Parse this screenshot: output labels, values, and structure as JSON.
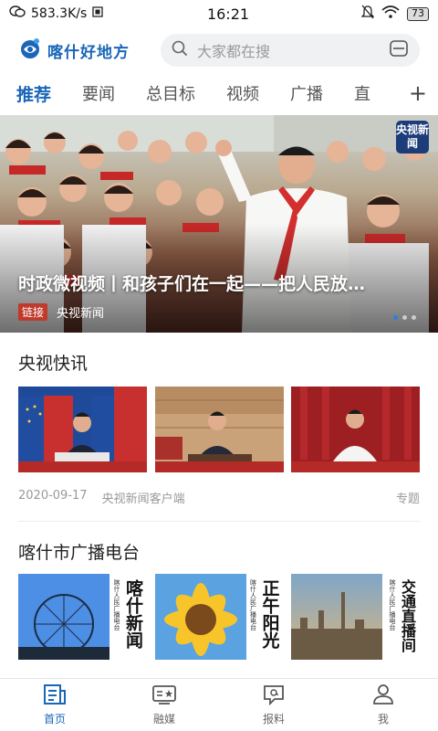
{
  "status_bar": {
    "net_speed": "583.3K/s",
    "time": "16:21",
    "battery": "73"
  },
  "header": {
    "logo_text": "喀什好地方",
    "search_placeholder": "大家都在搜"
  },
  "tabs": [
    {
      "label": "推荐",
      "active": true
    },
    {
      "label": "要闻"
    },
    {
      "label": "总目标"
    },
    {
      "label": "视频"
    },
    {
      "label": "广播"
    },
    {
      "label": "直"
    }
  ],
  "tabs_more": "+",
  "banner": {
    "title": "时政微视频丨和孩子们在一起——把人民放…",
    "tag": "链接",
    "source": "央视新闻",
    "badge": "央视新闻",
    "page_count": 3,
    "active_page": 1
  },
  "sections": {
    "news": {
      "title": "央视快讯",
      "date": "2020-09-17",
      "source": "央视新闻客户端",
      "topic": "专题"
    },
    "radio": {
      "title": "喀什市广播电台",
      "cards": [
        {
          "headline": "喀什新闻",
          "station": "喀什人民广播电台"
        },
        {
          "headline": "正午阳光",
          "station": "喀什人民广播电台"
        },
        {
          "headline": "交通直播间",
          "station": "喀什人民广播电台"
        }
      ]
    }
  },
  "bottom_nav": [
    {
      "label": "首页",
      "icon": "news-icon",
      "active": true
    },
    {
      "label": "融媒",
      "icon": "media-icon"
    },
    {
      "label": "报料",
      "icon": "report-icon"
    },
    {
      "label": "我",
      "icon": "user-icon"
    }
  ],
  "colors": {
    "brand": "#1a66b8",
    "tag_red": "#c0392b",
    "dot_active": "#2f7de1"
  }
}
